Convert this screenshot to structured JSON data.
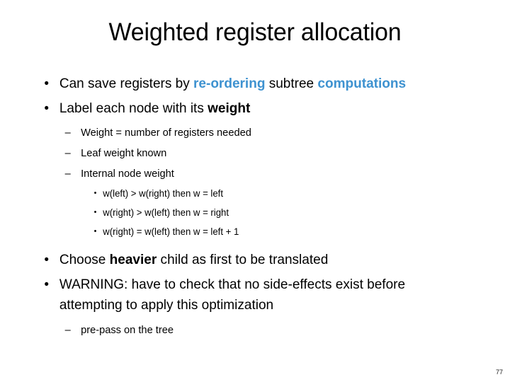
{
  "slide": {
    "title": "Weighted register allocation",
    "page_number": "77",
    "accent_color": "#3E92D0",
    "text_color": "#000000",
    "background_color": "#FFFFFF"
  },
  "markers": {
    "level1": "•",
    "level2": "–",
    "level3": "•"
  },
  "content": {
    "b1": {
      "part1": "Can save registers by ",
      "accent1": "re-ordering",
      "part2": " subtree ",
      "accent2": "computations"
    },
    "b2": {
      "part1": "Label each node with its ",
      "bold1": "weight"
    },
    "b2s1": "Weight = number of registers needed",
    "b2s2": "Leaf weight known",
    "b2s3": "Internal node weight",
    "b2s3a": "w(left) > w(right) then w = left",
    "b2s3b": "w(right) > w(left) then w = right",
    "b2s3c": "w(right) = w(left) then w = left + 1",
    "b3": {
      "part1": "Choose ",
      "bold1": "heavier",
      "part2": " child as first to be translated"
    },
    "b4": "WARNING: have to check that no side-effects exist before attempting to apply this optimization",
    "b4s1": "pre-pass on the tree"
  }
}
